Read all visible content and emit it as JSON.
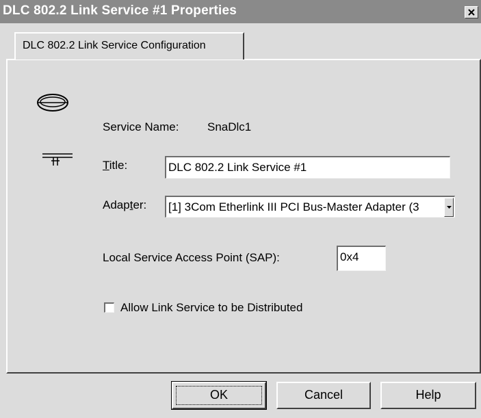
{
  "window": {
    "title": "DLC 802.2 Link Service #1 Properties",
    "close_glyph": "×"
  },
  "tabs": [
    {
      "label": "DLC 802.2 Link Service Configuration",
      "active": true
    }
  ],
  "service": {
    "name_label": "Service Name:",
    "name_value": "SnaDlc1"
  },
  "title_field": {
    "label_first": "T",
    "label_rest": "itle:",
    "value": "DLC 802.2 Link Service #1"
  },
  "adapter": {
    "label_first": "Adap",
    "label_underlined": "t",
    "label_rest": "er:",
    "selected": "[1] 3Com Etherlink III PCI Bus-Master Adapter (3"
  },
  "sap": {
    "label": "Local Service Access Point (SAP):",
    "value": "0x4"
  },
  "distribute": {
    "label": "Allow Link Service to be Distributed",
    "checked": false
  },
  "buttons": {
    "ok": "OK",
    "cancel": "Cancel",
    "help": "Help"
  },
  "icons": {
    "ring": "token-ring-icon",
    "network": "network-tap-icon",
    "dropdown": "chevron-down-icon",
    "close": "close-icon"
  },
  "colors": {
    "titlebar": "#8a8a8a",
    "face": "#dcdcdc"
  }
}
